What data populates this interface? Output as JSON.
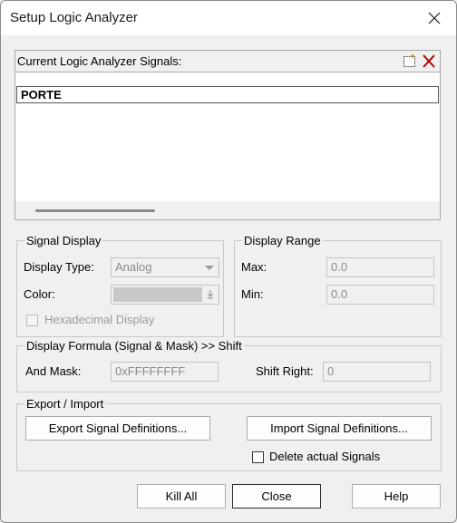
{
  "window": {
    "title": "Setup Logic Analyzer",
    "close_glyph": "✕"
  },
  "signals": {
    "header": "Current Logic Analyzer Signals:",
    "items": [
      "PORTE"
    ],
    "new_icon": "new-signal-icon",
    "delete_icon": "delete-signal-icon"
  },
  "signal_display": {
    "legend": "Signal Display",
    "display_type_label": "Display Type:",
    "display_type_value": "Analog",
    "color_label": "Color:",
    "hex_display_label": "Hexadecimal Display",
    "hex_display_checked": false
  },
  "display_range": {
    "legend": "Display Range",
    "max_label": "Max:",
    "max_value": "0.0",
    "min_label": "Min:",
    "min_value": "0.0"
  },
  "formula": {
    "legend": "Display Formula (Signal & Mask) >> Shift",
    "and_mask_label": "And Mask:",
    "and_mask_value": "0xFFFFFFFF",
    "shift_right_label": "Shift Right:",
    "shift_right_value": "0"
  },
  "export_import": {
    "legend": "Export / Import",
    "export_label": "Export Signal Definitions...",
    "import_label": "Import Signal Definitions...",
    "delete_actual_label": "Delete actual Signals",
    "delete_actual_checked": false
  },
  "footer": {
    "kill_all": "Kill All",
    "close": "Close",
    "help": "Help"
  },
  "colors": {
    "dialog_bg": "#f0f0f0",
    "titlebar_bg": "#ffffff",
    "disabled_text": "#8a8a8a",
    "delete_icon": "#b00000"
  }
}
